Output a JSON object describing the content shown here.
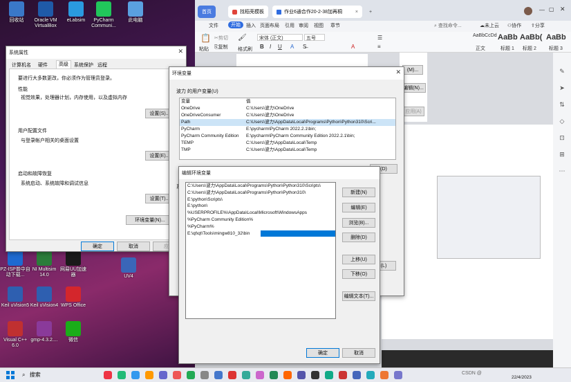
{
  "desktop": {
    "icons": [
      {
        "label": "回收站",
        "icon": "recycle-bin-icon",
        "color": "#3a78c8"
      },
      {
        "label": "Oracle VM VirtualBox",
        "icon": "virtualbox-icon",
        "color": "#1f5aa8"
      },
      {
        "label": "eLabsim",
        "icon": "elabsim-icon",
        "color": "#2a9adf"
      },
      {
        "label": "PyCharm Communi...",
        "icon": "pycharm-icon",
        "color": "#21c65b"
      },
      {
        "label": "此电脑",
        "icon": "computer-icon",
        "color": "#5aa0e0"
      },
      {
        "label": "PZ-ISP普中自动下载...",
        "icon": "pz-isp-icon",
        "color": "#1e6ad0"
      },
      {
        "label": "NI Multisim 14.0",
        "icon": "multisim-icon",
        "color": "#2b7d3a"
      },
      {
        "label": "网易UU加速器",
        "icon": "uu-icon",
        "color": "#1a1a1a"
      },
      {
        "label": "UV4",
        "icon": "uv4-icon",
        "color": "#3a66b8"
      },
      {
        "label": "Keil uVision5",
        "icon": "keil5-icon",
        "color": "#2e5fb0"
      },
      {
        "label": "Keil uVision4",
        "icon": "keil4-icon",
        "color": "#2e5fb0"
      },
      {
        "label": "WPS Office",
        "icon": "wps-icon",
        "color": "#d4262c"
      },
      {
        "label": "Visual C++ 6.0",
        "icon": "vc6-icon",
        "color": "#c03030"
      },
      {
        "label": "gmp-4.3.2....",
        "icon": "archive-icon",
        "color": "#8a3a9a"
      },
      {
        "label": "微信",
        "icon": "wechat-icon",
        "color": "#1aad19"
      }
    ]
  },
  "wps": {
    "tabs": [
      {
        "label": "首页"
      },
      {
        "label": "找稻壳模板"
      },
      {
        "label": "作业6通合作20-2-38加再桐"
      }
    ],
    "menu": [
      "文件",
      "开始",
      "插入",
      "页面布局",
      "引用",
      "审阅",
      "视图",
      "章节"
    ],
    "menu_right": [
      "查找命令...",
      "未上云",
      "协作",
      "分享"
    ],
    "ribbon": {
      "cut": "剪切",
      "copy": "复制",
      "paste": "粘贴",
      "format_painter": "格式刷",
      "font": "宋体 (正文)",
      "size": "五号",
      "styles": [
        {
          "preview": "AaBbCcDd",
          "name": "正文"
        },
        {
          "preview": "AaBb",
          "name": "标题 1"
        },
        {
          "preview": "AaBb(",
          "name": "标题 2"
        },
        {
          "preview": "AaBb",
          "name": "标题 3"
        }
      ]
    },
    "behind_doc_buttons": [
      "(M)...",
      "编辑(N)...",
      "应用(A)"
    ]
  },
  "sysprops": {
    "title": "系统属性",
    "tabs": [
      "计算机名",
      "硬件",
      "高级",
      "系统保护",
      "远程"
    ],
    "admin_note": "要进行大多数更改，你必须作为管理员登录。",
    "performance": {
      "title": "性能",
      "desc": "视觉效果，处理器计划，内存使用，以及虚拟内存",
      "button": "设置(S)..."
    },
    "profiles": {
      "title": "用户配置文件",
      "desc": "与登录帐户相关的桌面设置",
      "button": "设置(E)..."
    },
    "startup": {
      "title": "启动和故障恢复",
      "desc": "系统启动、系统故障和调试信息",
      "button": "设置(T)..."
    },
    "env_button": "环境变量(N)...",
    "ok": "确定",
    "cancel": "取消",
    "apply": "应用"
  },
  "envvars": {
    "title": "环境变量",
    "user_section": "波力 的用户变量(U)",
    "col_var": "变量",
    "col_val": "值",
    "rows": [
      {
        "var": "OneDrive",
        "val": "C:\\Users\\波力\\OneDrive"
      },
      {
        "var": "OneDriveConsumer",
        "val": "C:\\Users\\波力\\OneDrive"
      },
      {
        "var": "Path",
        "val": "C:\\Users\\波力\\AppData\\Local\\Programs\\Python\\Python310\\Scri..."
      },
      {
        "var": "PyCharm",
        "val": "E:\\pycharm\\PyCharm 2022.2.1\\bin;"
      },
      {
        "var": "PyCharm Community Edition",
        "val": "E:\\pycharm\\PyCharm Community Edition 2022.2.1\\bin;"
      },
      {
        "var": "TEMP",
        "val": "C:\\Users\\波力\\AppData\\Local\\Temp"
      },
      {
        "var": "TMP",
        "val": "C:\\Users\\波力\\AppData\\Local\\Temp"
      }
    ],
    "sys_label": "系",
    "bottom_button": "(L)",
    "partial_button": "(D)"
  },
  "editenv": {
    "title": "编辑环境变量",
    "paths": [
      "C:\\Users\\波力\\AppData\\Local\\Programs\\Python\\Python310\\Scripts\\",
      "C:\\Users\\波力\\AppData\\Local\\Programs\\Python\\Python310\\",
      "E:\\python\\Scripts\\",
      "E:\\python\\",
      "%USERPROFILE%\\AppData\\Local\\Microsoft\\WindowsApps",
      "%PyCharm Community Edition%",
      "%PyCharm%",
      "E:\\qt\\qt\\Tools\\mingw810_32\\bin"
    ],
    "buttons": {
      "new": "新建(N)",
      "edit": "编辑(E)",
      "browse": "浏览(B)...",
      "delete": "删除(D)",
      "up": "上移(U)",
      "down": "下移(O)",
      "edit_text": "编辑文本(T)...",
      "ok": "确定",
      "cancel": "取消"
    }
  },
  "taskbar": {
    "search": "搜索",
    "date": "22/4/2023",
    "watermark": "CSDN @"
  }
}
